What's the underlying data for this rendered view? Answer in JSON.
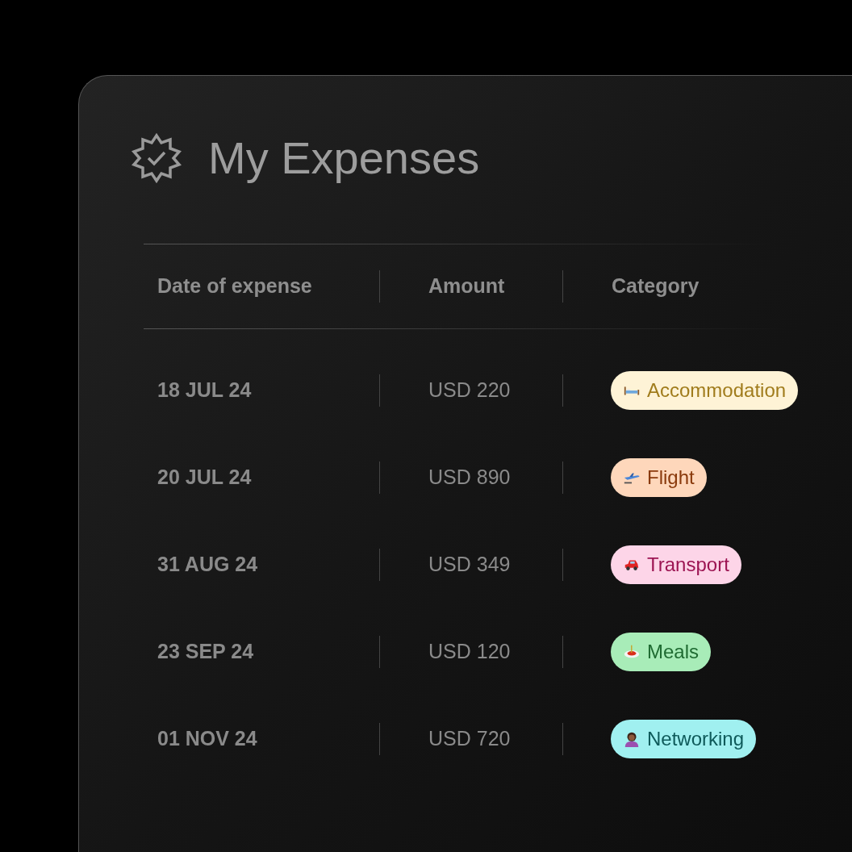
{
  "title": "My Expenses",
  "table": {
    "columns": [
      "Date of expense",
      "Amount",
      "Category"
    ],
    "rows": [
      {
        "date": "18 JUL 24",
        "amount": "USD 220",
        "category": {
          "label": "Accommodation",
          "kind": "bed",
          "color": "#fef3d6"
        }
      },
      {
        "date": "20 JUL 24",
        "amount": "USD 890",
        "category": {
          "label": "Flight",
          "kind": "plane",
          "color": "#fed7bb"
        }
      },
      {
        "date": "31 AUG 24",
        "amount": "USD 349",
        "category": {
          "label": "Transport",
          "kind": "car",
          "color": "#fdd5e8"
        }
      },
      {
        "date": "23 SEP 24",
        "amount": "USD 120",
        "category": {
          "label": "Meals",
          "kind": "food",
          "color": "#a8ecb8"
        }
      },
      {
        "date": "01 NOV 24",
        "amount": "USD 720",
        "category": {
          "label": "Networking",
          "kind": "person",
          "color": "#a0f0f0"
        }
      }
    ]
  }
}
